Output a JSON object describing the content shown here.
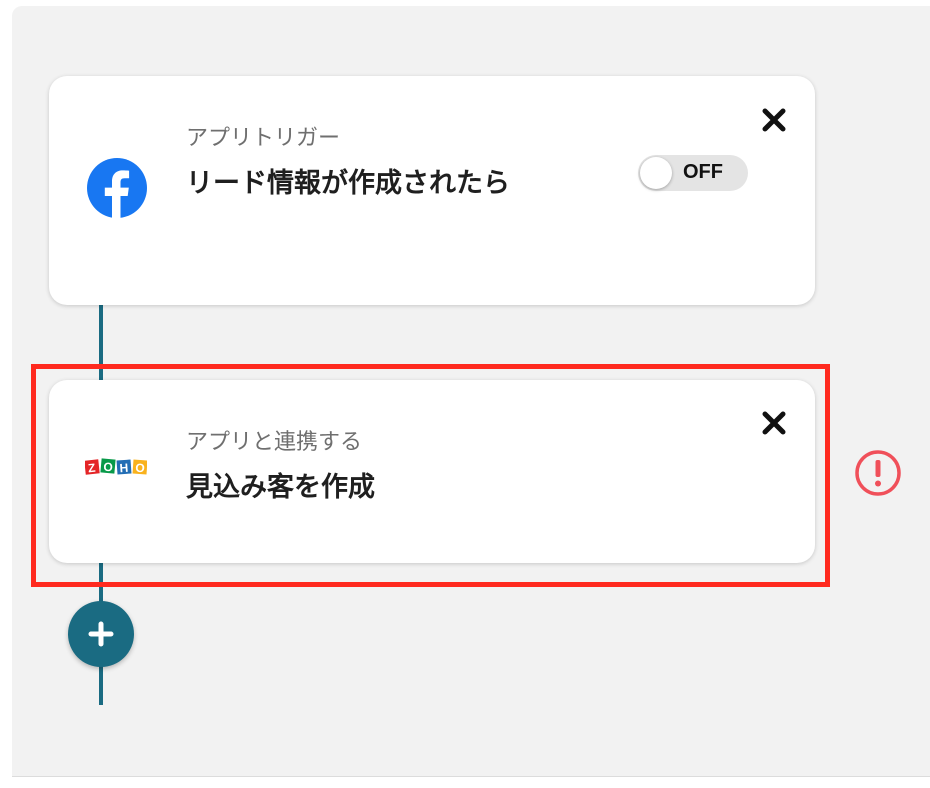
{
  "flow": {
    "trigger": {
      "label": "アプリトリガー",
      "title": "リード情報が作成されたら",
      "app_icon": "facebook-icon",
      "toggle": {
        "state": "OFF"
      }
    },
    "action": {
      "label": "アプリと連携する",
      "title": "見込み客を作成",
      "app_icon": "zoho-icon"
    }
  },
  "colors": {
    "connector": "#1a6b82",
    "highlight": "#ff2a1f",
    "warning": "#f0505a",
    "facebook": "#1877f2"
  }
}
